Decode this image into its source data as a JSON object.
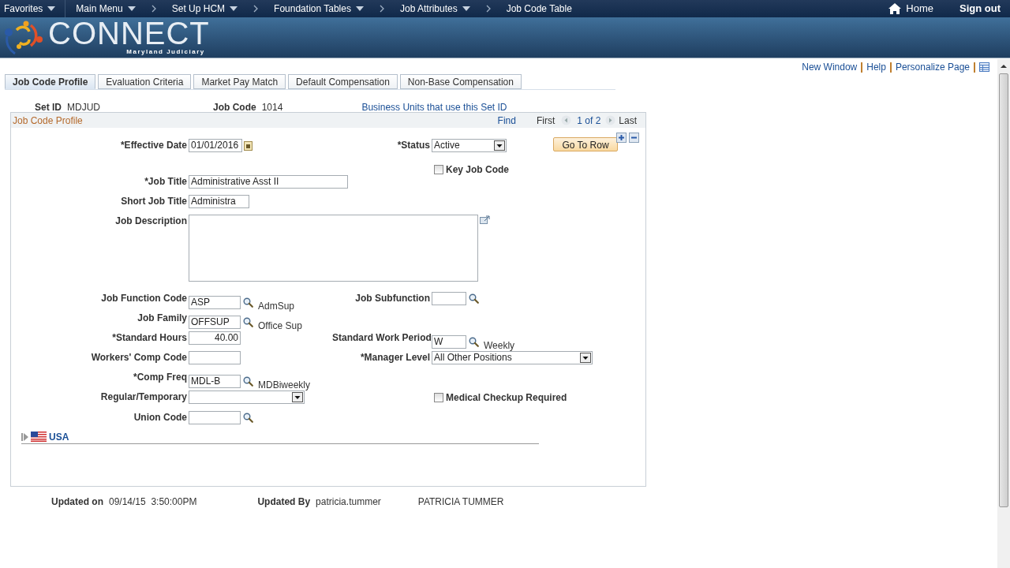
{
  "nav": {
    "items": [
      {
        "label": "Favorites",
        "kind": "menu",
        "dropdown": true
      },
      {
        "label": "Main Menu",
        "kind": "menu",
        "dropdown": true
      },
      {
        "label": "Set Up HCM",
        "kind": "crumb",
        "dropdown": true
      },
      {
        "label": "Foundation Tables",
        "kind": "crumb",
        "dropdown": true
      },
      {
        "label": "Job Attributes",
        "kind": "crumb",
        "dropdown": true
      },
      {
        "label": "Job Code Table",
        "kind": "crumb",
        "dropdown": false
      }
    ],
    "home": "Home",
    "sign_out": "Sign out"
  },
  "banner": {
    "logo_text": "CONNECT",
    "logo_subtitle": "Maryland Judiciary"
  },
  "page_links": [
    "New Window",
    "Help",
    "Personalize Page"
  ],
  "tabs": [
    {
      "label": "Job Code Profile",
      "selected": true
    },
    {
      "label": "Evaluation Criteria",
      "selected": false
    },
    {
      "label": "Market Pay Match",
      "selected": false
    },
    {
      "label": "Default Compensation",
      "selected": false
    },
    {
      "label": "Non-Base Compensation",
      "selected": false
    }
  ],
  "keys": {
    "set_id_label": "Set ID",
    "set_id": "MDJUD",
    "job_code_label": "Job Code",
    "job_code": "1014",
    "link": "Business Units that use this Set ID"
  },
  "panel": {
    "title": "Job Code Profile",
    "find": "Find",
    "first": "First",
    "position": "1 of 2",
    "last": "Last",
    "go_to_row": "Go To Row"
  },
  "rows": [
    {
      "left": {
        "kind": "date",
        "label": "*Effective Date",
        "value": "01/01/2016"
      },
      "right": {
        "kind": "select",
        "label": "*Status",
        "value": "Active"
      }
    },
    {
      "right": {
        "kind": "checkbox",
        "label": "Key Job Code",
        "checked": false
      }
    },
    {
      "left": {
        "kind": "text",
        "label": "*Job Title",
        "value": "Administrative Asst II"
      }
    },
    {
      "left": {
        "kind": "text",
        "label": "Short Job Title",
        "value": "Administra"
      }
    },
    {
      "left": {
        "kind": "textarea",
        "label": "Job Description"
      }
    },
    {
      "left": {
        "kind": "lookup",
        "label": "Job Function Code",
        "value": "ASP",
        "description": "AdmSup"
      },
      "right": {
        "kind": "lookup",
        "label": "Job Subfunction"
      }
    },
    {
      "left": {
        "kind": "lookup",
        "label": "Job Family",
        "value": "OFFSUP",
        "description": "Office Sup"
      }
    },
    {
      "left": {
        "kind": "number",
        "label": "*Standard Hours",
        "value": "40.00"
      },
      "right": {
        "kind": "lookup",
        "label": "Standard Work Period",
        "value": "W",
        "description": "Weekly"
      }
    },
    {
      "left": {
        "kind": "text",
        "label": "Workers' Comp Code"
      },
      "right": {
        "kind": "select",
        "label": "*Manager Level",
        "value": "All Other Positions"
      }
    },
    {
      "left": {
        "kind": "lookup",
        "label": "*Comp Freq",
        "value": "MDL-B",
        "description": "MDBiweekly"
      }
    },
    {
      "left": {
        "kind": "select",
        "label": "Regular/Temporary"
      },
      "right": {
        "kind": "checkbox",
        "label": "Medical Checkup Required",
        "checked": false
      }
    },
    {
      "left": {
        "kind": "lookup",
        "label": "Union Code"
      }
    }
  ],
  "country_section": {
    "label": "USA",
    "expanded": false
  },
  "footer": {
    "updated_on_label": "Updated on",
    "updated_on": "09/14/15  3:50:00PM",
    "updated_by_label": "Updated By",
    "updated_by": "patricia.tummer",
    "name": "PATRICIA TUMMER"
  }
}
